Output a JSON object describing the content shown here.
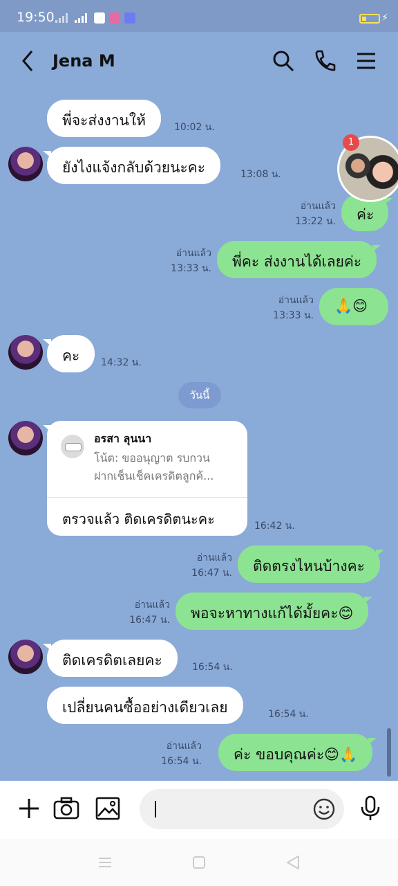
{
  "status_bar": {
    "time": "19:50"
  },
  "header": {
    "contact_name": "Jena M"
  },
  "messages": [
    {
      "dir": "in",
      "text": "พี่จะส่งงานให้",
      "time": "10:02 น."
    },
    {
      "dir": "in",
      "text": "ยังไงแจ้งกลับด้วยนะคะ",
      "time": "13:08 น."
    },
    {
      "dir": "out",
      "text": "ค่ะ",
      "read": "อ่านแล้ว",
      "time": "13:22 น."
    },
    {
      "dir": "out",
      "text": "พี่คะ ส่งงานได้เลยค่ะ",
      "read": "อ่านแล้ว",
      "time": "13:33 น."
    },
    {
      "dir": "out",
      "text": "🙏😊",
      "read": "อ่านแล้ว",
      "time": "13:33 น."
    },
    {
      "dir": "in",
      "text": "คะ",
      "time": "14:32 น."
    },
    {
      "dir": "out",
      "text": "ติดตรงไหนบ้างคะ",
      "read": "อ่านแล้ว",
      "time": "16:47 น."
    },
    {
      "dir": "out",
      "text": "พอจะหาทางแก้ได้มั้ยคะ😊",
      "read": "อ่านแล้ว",
      "time": "16:47 น."
    },
    {
      "dir": "in",
      "text": "ติดเครดิตเลยคะ",
      "time": "16:54 น."
    },
    {
      "dir": "in",
      "text": "เปลี่ยนคนซื้ออย่างเดียวเลย",
      "time": "16:54 น."
    },
    {
      "dir": "out",
      "text": "ค่ะ ขอบคุณค่ะ😊🙏",
      "read": "อ่านแล้ว",
      "time": "16:54 น."
    }
  ],
  "day_separator": "วันนี้",
  "reply_card": {
    "name": "อรสา ลุนนา",
    "note_line1": "โน้ต: ขออนุญาต รบกวน",
    "note_line2": "ฝากเช็นเช็คเครดิตลูกค้...",
    "message": "ตรวจแล้ว ติดเครดิตนะคะ",
    "time": "16:42 น."
  },
  "floating_avatar": {
    "badge": "1"
  },
  "input_bar": {
    "placeholder": ""
  },
  "icons": [
    "back-icon",
    "search-icon",
    "phone-icon",
    "menu-icon",
    "plus-icon",
    "camera-icon",
    "image-icon",
    "emoji-icon",
    "mic-icon"
  ]
}
